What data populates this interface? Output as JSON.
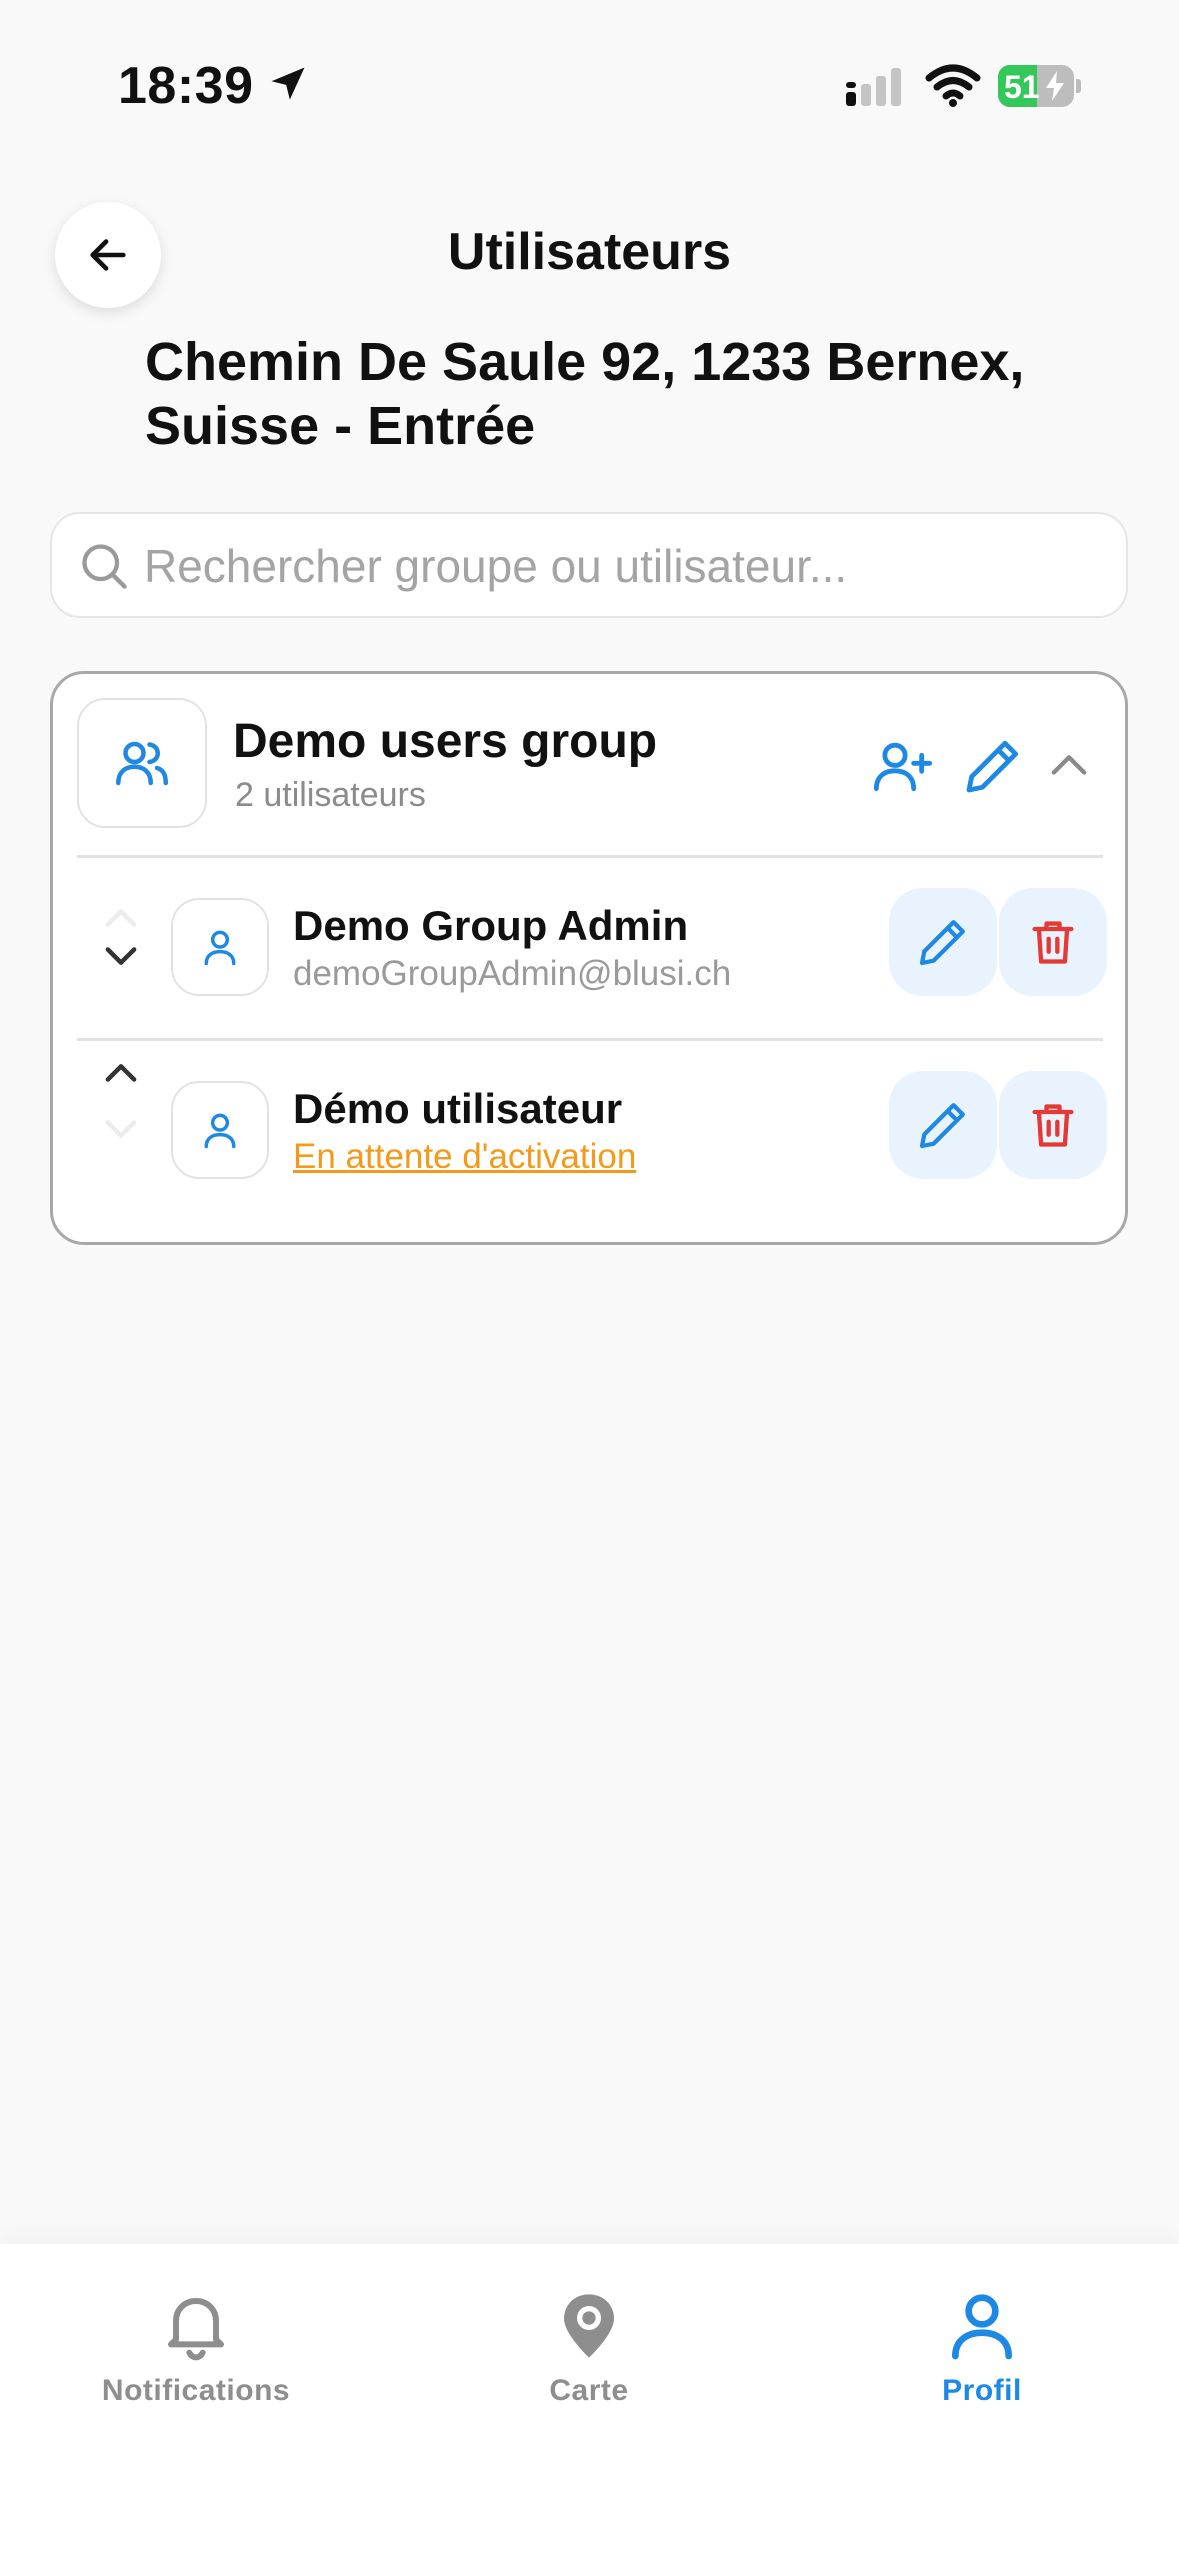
{
  "status_bar": {
    "time": "18:39",
    "battery_level": "51",
    "battery_percent": 51,
    "icons": [
      "location-arrow-icon",
      "cellular-signal-icon",
      "wifi-icon",
      "battery-charging-icon"
    ]
  },
  "header": {
    "title": "Utilisateurs",
    "address": "Chemin De Saule 92, 1233 Bernex, Suisse - Entrée"
  },
  "search": {
    "placeholder": "Rechercher groupe ou utilisateur...",
    "value": ""
  },
  "group": {
    "name": "Demo users group",
    "count_label": "2 utilisateurs",
    "users": [
      {
        "name": "Demo Group Admin",
        "subtitle": "demoGroupAdmin@blusi.ch",
        "status": "active"
      },
      {
        "name": "Démo utilisateur",
        "subtitle": "En attente d'activation",
        "status": "pending"
      }
    ]
  },
  "tabs": [
    {
      "label": "Notifications",
      "icon": "bell-icon",
      "active": false
    },
    {
      "label": "Carte",
      "icon": "map-pin-icon",
      "active": false
    },
    {
      "label": "Profil",
      "icon": "user-icon",
      "active": true
    }
  ],
  "colors": {
    "accent": "#1e88e5",
    "danger": "#e53935",
    "warning": "#f39a1b",
    "background": "#f9f9f9"
  }
}
